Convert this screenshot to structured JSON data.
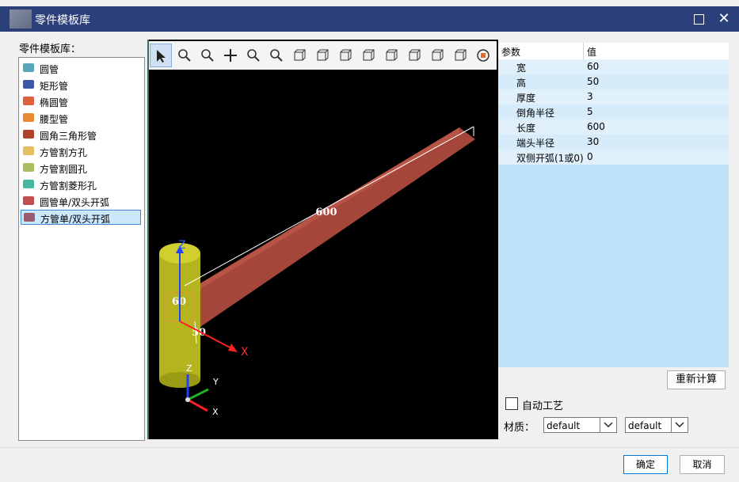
{
  "window": {
    "title": "零件模板库"
  },
  "library": {
    "label": "零件模板库：",
    "items": [
      {
        "label": "圆管",
        "color": "#5aa6b8"
      },
      {
        "label": "矩形管",
        "color": "#3b57a8"
      },
      {
        "label": "椭圆管",
        "color": "#e06040"
      },
      {
        "label": "腰型管",
        "color": "#e88b30"
      },
      {
        "label": "圆角三角形管",
        "color": "#b0402c"
      },
      {
        "label": "方管割方孔",
        "color": "#e6c060"
      },
      {
        "label": "方管割圆孔",
        "color": "#a8c060"
      },
      {
        "label": "方管割菱形孔",
        "color": "#48b8a0"
      },
      {
        "label": "圆管单/双头开弧",
        "color": "#c05050"
      },
      {
        "label": "方管单/双头开弧",
        "color": "#9a5a70"
      }
    ],
    "selected_index": 9
  },
  "toolbar": {
    "icons": [
      "select-arrow-icon",
      "zoom-window-icon",
      "zoom-icon",
      "pan-icon",
      "rotate-icon",
      "zoom-fit-icon",
      "view-cube-front-icon",
      "view-cube-back-icon",
      "view-cube-left-icon",
      "view-cube-right-icon",
      "view-cube-top-icon",
      "view-cube-bottom-icon",
      "view-iso-icon",
      "view-iso2-icon",
      "view-3d-icon"
    ]
  },
  "scene": {
    "dim_length": "600",
    "dim_width": "60",
    "dim_height": "50",
    "axis_big": {
      "z": "Z",
      "x": "X"
    },
    "axis_small": {
      "z": "Z",
      "y": "Y",
      "x": "X"
    }
  },
  "params": {
    "header_key": "参数",
    "header_value": "值",
    "rows": [
      {
        "key": "宽",
        "value": "60"
      },
      {
        "key": "高",
        "value": "50"
      },
      {
        "key": "厚度",
        "value": "3"
      },
      {
        "key": "倒角半径",
        "value": "5"
      },
      {
        "key": "长度",
        "value": "600"
      },
      {
        "key": "端头半径",
        "value": "30"
      },
      {
        "key": "双侧开弧(1或0)",
        "value": "0"
      }
    ]
  },
  "recalc_label": "重新计算",
  "auto_process": {
    "label": "自动工艺",
    "checked": false
  },
  "material": {
    "label": "材质：",
    "value1": "default",
    "value2": "default"
  },
  "buttons": {
    "ok": "确定",
    "cancel": "取消"
  }
}
